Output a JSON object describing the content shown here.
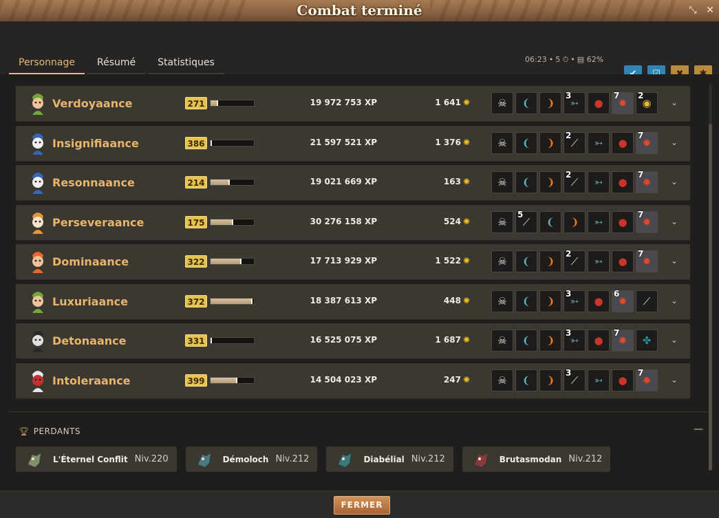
{
  "window": {
    "title": "Combat terminé"
  },
  "tabs": [
    {
      "label": "Personnage",
      "active": true
    },
    {
      "label": "Résumé",
      "active": false
    },
    {
      "label": "Statistiques",
      "active": false
    }
  ],
  "fight_stats": {
    "duration": "06:23",
    "turns": "5",
    "percent": "62%"
  },
  "header_icons": [
    "ally-check-icon",
    "team-check-icon",
    "character-lock-icon",
    "monster-lock-icon"
  ],
  "colors": {
    "accent": "#e9b96f",
    "level_badge": "#e6c24e",
    "kamas": "#f0c21f",
    "button": "#b87442"
  },
  "winners": [
    {
      "name": "Verdoyaance",
      "level": "271",
      "xp_progress": 0.18,
      "xp": "19 972 753 XP",
      "kamas": "1 641",
      "items": [
        {
          "icon": "skull-charm-icon",
          "qty": ""
        },
        {
          "icon": "blade-icon",
          "qty": ""
        },
        {
          "icon": "flame-tail-icon",
          "qty": ""
        },
        {
          "icon": "fish-icon",
          "qty": "3"
        },
        {
          "icon": "red-shell-icon",
          "qty": ""
        },
        {
          "icon": "dragon-icon",
          "qty": "7"
        },
        {
          "icon": "gold-orb-icon",
          "qty": "2"
        }
      ]
    },
    {
      "name": "Insignifiaance",
      "level": "386",
      "xp_progress": 0.03,
      "xp": "21 597 521 XP",
      "kamas": "1 376",
      "items": [
        {
          "icon": "skull-charm-icon",
          "qty": ""
        },
        {
          "icon": "blade-icon",
          "qty": ""
        },
        {
          "icon": "flame-tail-icon",
          "qty": ""
        },
        {
          "icon": "bone-blade-icon",
          "qty": "2"
        },
        {
          "icon": "fish-icon",
          "qty": ""
        },
        {
          "icon": "red-shell-icon",
          "qty": ""
        },
        {
          "icon": "dragon-icon",
          "qty": "7"
        }
      ]
    },
    {
      "name": "Resonnaance",
      "level": "214",
      "xp_progress": 0.45,
      "xp": "19 021 669 XP",
      "kamas": "163",
      "items": [
        {
          "icon": "skull-charm-icon",
          "qty": ""
        },
        {
          "icon": "blade-icon",
          "qty": ""
        },
        {
          "icon": "flame-tail-icon",
          "qty": ""
        },
        {
          "icon": "bone-blade-icon",
          "qty": "2"
        },
        {
          "icon": "fish-icon",
          "qty": ""
        },
        {
          "icon": "red-shell-icon",
          "qty": ""
        },
        {
          "icon": "dragon-icon",
          "qty": "7"
        }
      ]
    },
    {
      "name": "Perseveraance",
      "level": "175",
      "xp_progress": 0.52,
      "xp": "30 276 158 XP",
      "kamas": "524",
      "items": [
        {
          "icon": "skull-charm-icon",
          "qty": ""
        },
        {
          "icon": "bone-blade-icon",
          "qty": "5"
        },
        {
          "icon": "blade-icon",
          "qty": ""
        },
        {
          "icon": "flame-tail-icon",
          "qty": ""
        },
        {
          "icon": "fish-icon",
          "qty": ""
        },
        {
          "icon": "red-shell-icon",
          "qty": ""
        },
        {
          "icon": "dragon-icon",
          "qty": "7"
        }
      ]
    },
    {
      "name": "Dominaance",
      "level": "322",
      "xp_progress": 0.72,
      "xp": "17 713 929 XP",
      "kamas": "1 522",
      "items": [
        {
          "icon": "skull-charm-icon",
          "qty": ""
        },
        {
          "icon": "blade-icon",
          "qty": ""
        },
        {
          "icon": "flame-tail-icon",
          "qty": ""
        },
        {
          "icon": "bone-blade-icon",
          "qty": "2"
        },
        {
          "icon": "fish-icon",
          "qty": ""
        },
        {
          "icon": "red-shell-icon",
          "qty": ""
        },
        {
          "icon": "dragon-icon",
          "qty": "7"
        }
      ]
    },
    {
      "name": "Luxuriaance",
      "level": "372",
      "xp_progress": 0.97,
      "xp": "18 387 613 XP",
      "kamas": "448",
      "items": [
        {
          "icon": "skull-charm-icon",
          "qty": ""
        },
        {
          "icon": "blade-icon",
          "qty": ""
        },
        {
          "icon": "flame-tail-icon",
          "qty": ""
        },
        {
          "icon": "fish-icon",
          "qty": "3"
        },
        {
          "icon": "red-shell-icon",
          "qty": ""
        },
        {
          "icon": "dragon-icon",
          "qty": "6"
        },
        {
          "icon": "bone-blade-icon",
          "qty": ""
        }
      ]
    },
    {
      "name": "Detonaance",
      "level": "331",
      "xp_progress": 0.02,
      "xp": "16 525 075 XP",
      "kamas": "1 687",
      "items": [
        {
          "icon": "skull-charm-icon",
          "qty": ""
        },
        {
          "icon": "blade-icon",
          "qty": ""
        },
        {
          "icon": "flame-tail-icon",
          "qty": ""
        },
        {
          "icon": "fish-icon",
          "qty": "3"
        },
        {
          "icon": "red-shell-icon",
          "qty": ""
        },
        {
          "icon": "dragon-icon",
          "qty": "7"
        },
        {
          "icon": "teal-claw-icon",
          "qty": ""
        }
      ]
    },
    {
      "name": "Intoleraance",
      "level": "399",
      "xp_progress": 0.62,
      "xp": "14 504 023 XP",
      "kamas": "247",
      "items": [
        {
          "icon": "skull-charm-icon",
          "qty": ""
        },
        {
          "icon": "blade-icon",
          "qty": ""
        },
        {
          "icon": "flame-tail-icon",
          "qty": ""
        },
        {
          "icon": "bone-blade-icon",
          "qty": "3"
        },
        {
          "icon": "fish-icon",
          "qty": ""
        },
        {
          "icon": "red-shell-icon",
          "qty": ""
        },
        {
          "icon": "dragon-icon",
          "qty": "7"
        }
      ]
    }
  ],
  "losers_section": {
    "title": "PERDANTS"
  },
  "losers": [
    {
      "name": "L'Éternel Conflit",
      "level": "Niv.220"
    },
    {
      "name": "Démoloch",
      "level": "Niv.212"
    },
    {
      "name": "Diabélial",
      "level": "Niv.212"
    },
    {
      "name": "Brutasmodan",
      "level": "Niv.212"
    }
  ],
  "footer": {
    "close_label": "FERMER"
  }
}
